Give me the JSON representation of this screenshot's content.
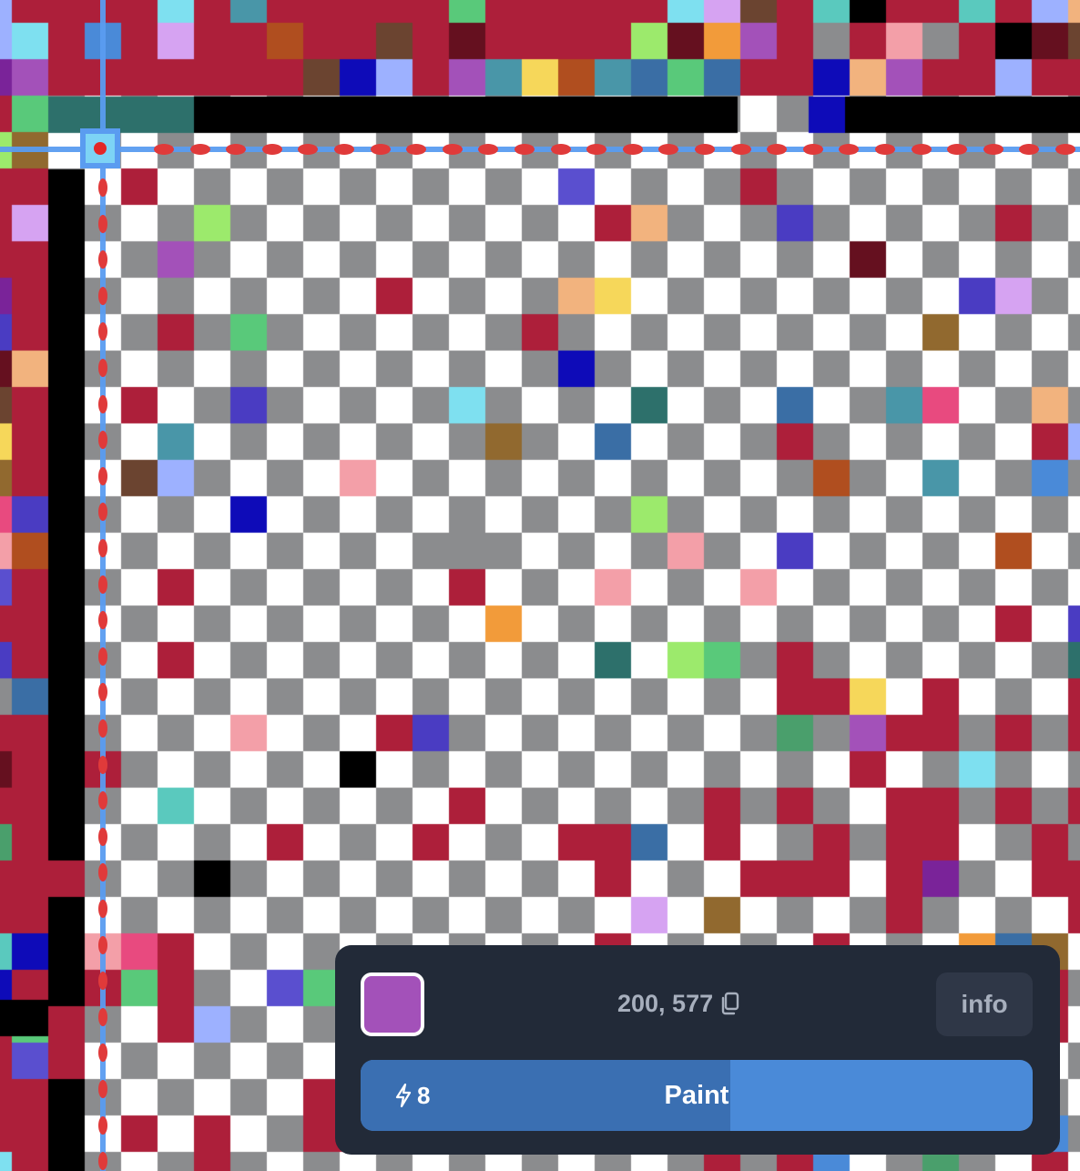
{
  "selection": {
    "color": "#a351b9",
    "coordinates": "200, 577",
    "copy_icon": "copy-icon"
  },
  "info_button": {
    "label": "info"
  },
  "paint_button": {
    "label": "Paint",
    "charges": "8",
    "charge_icon": "lightning-bolt-icon",
    "charge_progress": 0.55
  },
  "theme": {
    "panel_bg": "#222a38",
    "accent": "#4a8ad8",
    "accent_dark": "#3a6fb2",
    "guide": "#5a9cf0",
    "marker": "#e03a3a"
  }
}
